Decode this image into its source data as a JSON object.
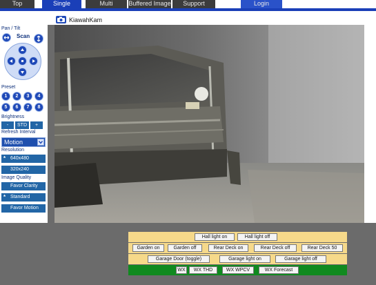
{
  "nav": {
    "tabs": [
      {
        "label": "Top"
      },
      {
        "label": "Single",
        "active": true
      },
      {
        "label": "Multi"
      },
      {
        "label": "Buffered Image"
      },
      {
        "label": "Support"
      },
      {
        "label": "Login"
      }
    ]
  },
  "camera": {
    "title": "KiawahKam"
  },
  "left": {
    "pan_tilt_label": "Pan / Tilt",
    "scan_label": "Scan",
    "preset_label": "Preset",
    "presets": [
      "1",
      "2",
      "3",
      "4",
      "5",
      "6",
      "7",
      "8"
    ],
    "brightness_label": "Brightness",
    "brightness": {
      "minus": "-",
      "std": "STD",
      "plus": "+"
    },
    "refresh_label": "Refresh Interval",
    "refresh_value": "Motion",
    "resolution_label": "Resolution",
    "resolutions": [
      {
        "label": "640x480",
        "selected": true
      },
      {
        "label": "320x240",
        "selected": false
      }
    ],
    "quality_label": "Image Quality",
    "qualities": [
      {
        "label": "Favor Clarity",
        "selected": false
      },
      {
        "label": "Standard",
        "selected": true
      },
      {
        "label": "Favor Motion",
        "selected": false
      }
    ],
    "selected_mark": "*"
  },
  "controls": {
    "row1": [
      "Hall light on",
      "Hall light off"
    ],
    "row2": [
      "Garden on",
      "Garden off",
      "Rear Deck on",
      "Rear Deck off",
      "Rear Deck 50"
    ],
    "row3": [
      "Garage Door (toggle)",
      "Garage light on",
      "Garage light off"
    ],
    "row4": [
      "WX",
      "WX THD",
      "WX WPCV",
      "WX Forecast"
    ]
  },
  "colors": {
    "nav_active": "#1a3fb8",
    "nav_inactive": "#3c3c3c",
    "control_bg": "#f6d98a",
    "wx_bg": "#108a1f",
    "left_button": "#2266a6"
  }
}
